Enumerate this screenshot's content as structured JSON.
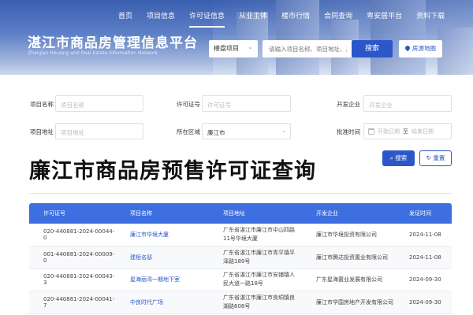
{
  "header": {
    "nav": [
      "首页",
      "项目信息",
      "许可证信息",
      "从业主体",
      "楼市行情",
      "合同查询",
      "粤安居平台",
      "资料下载"
    ],
    "site_title": "湛江市商品房管理信息平台",
    "site_subtitle": "Zhanjian Housing and Real Estate Information Network",
    "search_type": "楼盘项目",
    "search_placeholder": "请输入项目名称、项目地址、开",
    "search_label": "搜索",
    "map_label": "房源地图"
  },
  "filters": {
    "project_name_label": "项目名称",
    "project_name_placeholder": "项目名称",
    "license_no_label": "许可证号",
    "license_no_placeholder": "许可证号",
    "developer_label": "开发企业",
    "developer_placeholder": "开发企业",
    "address_label": "项目地址",
    "address_placeholder": "项目地址",
    "district_label": "所在区域",
    "district_value": "廉江市",
    "approval_label": "批准时间",
    "start_placeholder": "开始日期",
    "date_sep": "至",
    "end_placeholder": "结束日期",
    "query_label": "搜索",
    "reset_label": "重置"
  },
  "page_title": "廉江市商品房预售许可证查询",
  "table": {
    "headers": [
      "许可证号",
      "项目名称",
      "项目地址",
      "开发企业",
      "发证时间"
    ],
    "rows": [
      [
        "020-440881-2024-00044-0",
        "廉江市华境大厦",
        "广东省湛江市廉江市中山四路11号华境大厦",
        "廉江市华境投资有限公司",
        "2024-11-08"
      ],
      [
        "001-440881-2024-00009-0",
        "建栢名邸",
        "广东省湛江市廉江市青平镇平泽路189号",
        "廉江市腾达投资置业有限公司",
        "2024-11-08"
      ],
      [
        "020-440881-2024-00043-3",
        "星海丽湾一期地下室",
        "广东省湛江市廉江市安铺镇人民大道一路18号",
        "广东星海置业发展有限公司",
        "2024-09-30"
      ],
      [
        "020-440881-2024-00041-7",
        "中良时代广场",
        "广东省湛江市廉江市良垌镇良湖路608号",
        "廉江市华国房地产开发有限公司",
        "2024-09-30"
      ]
    ]
  }
}
